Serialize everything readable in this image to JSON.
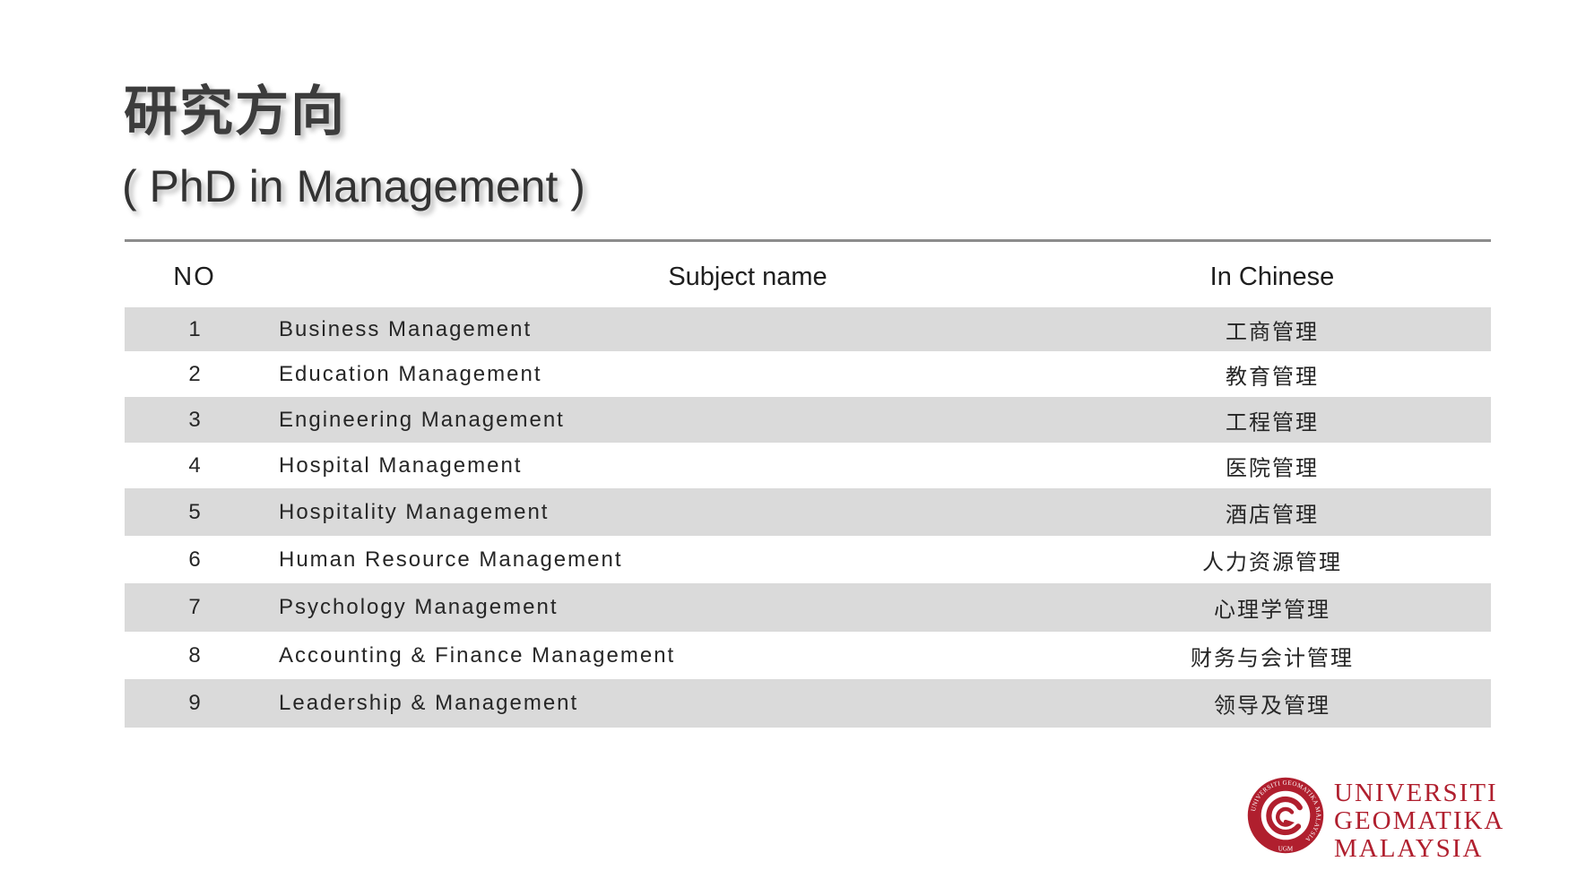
{
  "heading": {
    "title": "研究方向",
    "subtitle": "( PhD in Management )"
  },
  "table": {
    "headers": {
      "no": "NO",
      "subject": "Subject name",
      "chinese": "In Chinese"
    },
    "rows": [
      {
        "no": "1",
        "subject": "Business Management",
        "chinese": "工商管理"
      },
      {
        "no": "2",
        "subject": "Education Management",
        "chinese": "教育管理"
      },
      {
        "no": "3",
        "subject": "Engineering Management",
        "chinese": "工程管理"
      },
      {
        "no": "4",
        "subject": "Hospital Management",
        "chinese": "医院管理"
      },
      {
        "no": "5",
        "subject": "Hospitality Management",
        "chinese": "酒店管理"
      },
      {
        "no": "6",
        "subject": "Human Resource Management",
        "chinese": "人力资源管理"
      },
      {
        "no": "7",
        "subject": "Psychology Management",
        "chinese": "心理学管理"
      },
      {
        "no": "8",
        "subject": "Accounting & Finance Management",
        "chinese": "财务与会计管理"
      },
      {
        "no": "9",
        "subject": "Leadership & Management",
        "chinese": "领导及管理"
      }
    ]
  },
  "logo": {
    "lines": [
      "UNIVERSITI",
      "GEOMATIKA",
      "MALAYSIA"
    ],
    "seal_ring_text": "UNIVERSITI GEOMATIKA MALAYSIA",
    "seal_abbrev": "UGM",
    "color": "#b01f2e"
  },
  "colors": {
    "row_stripe": "#dadada",
    "rule": "#8c8c8c"
  }
}
